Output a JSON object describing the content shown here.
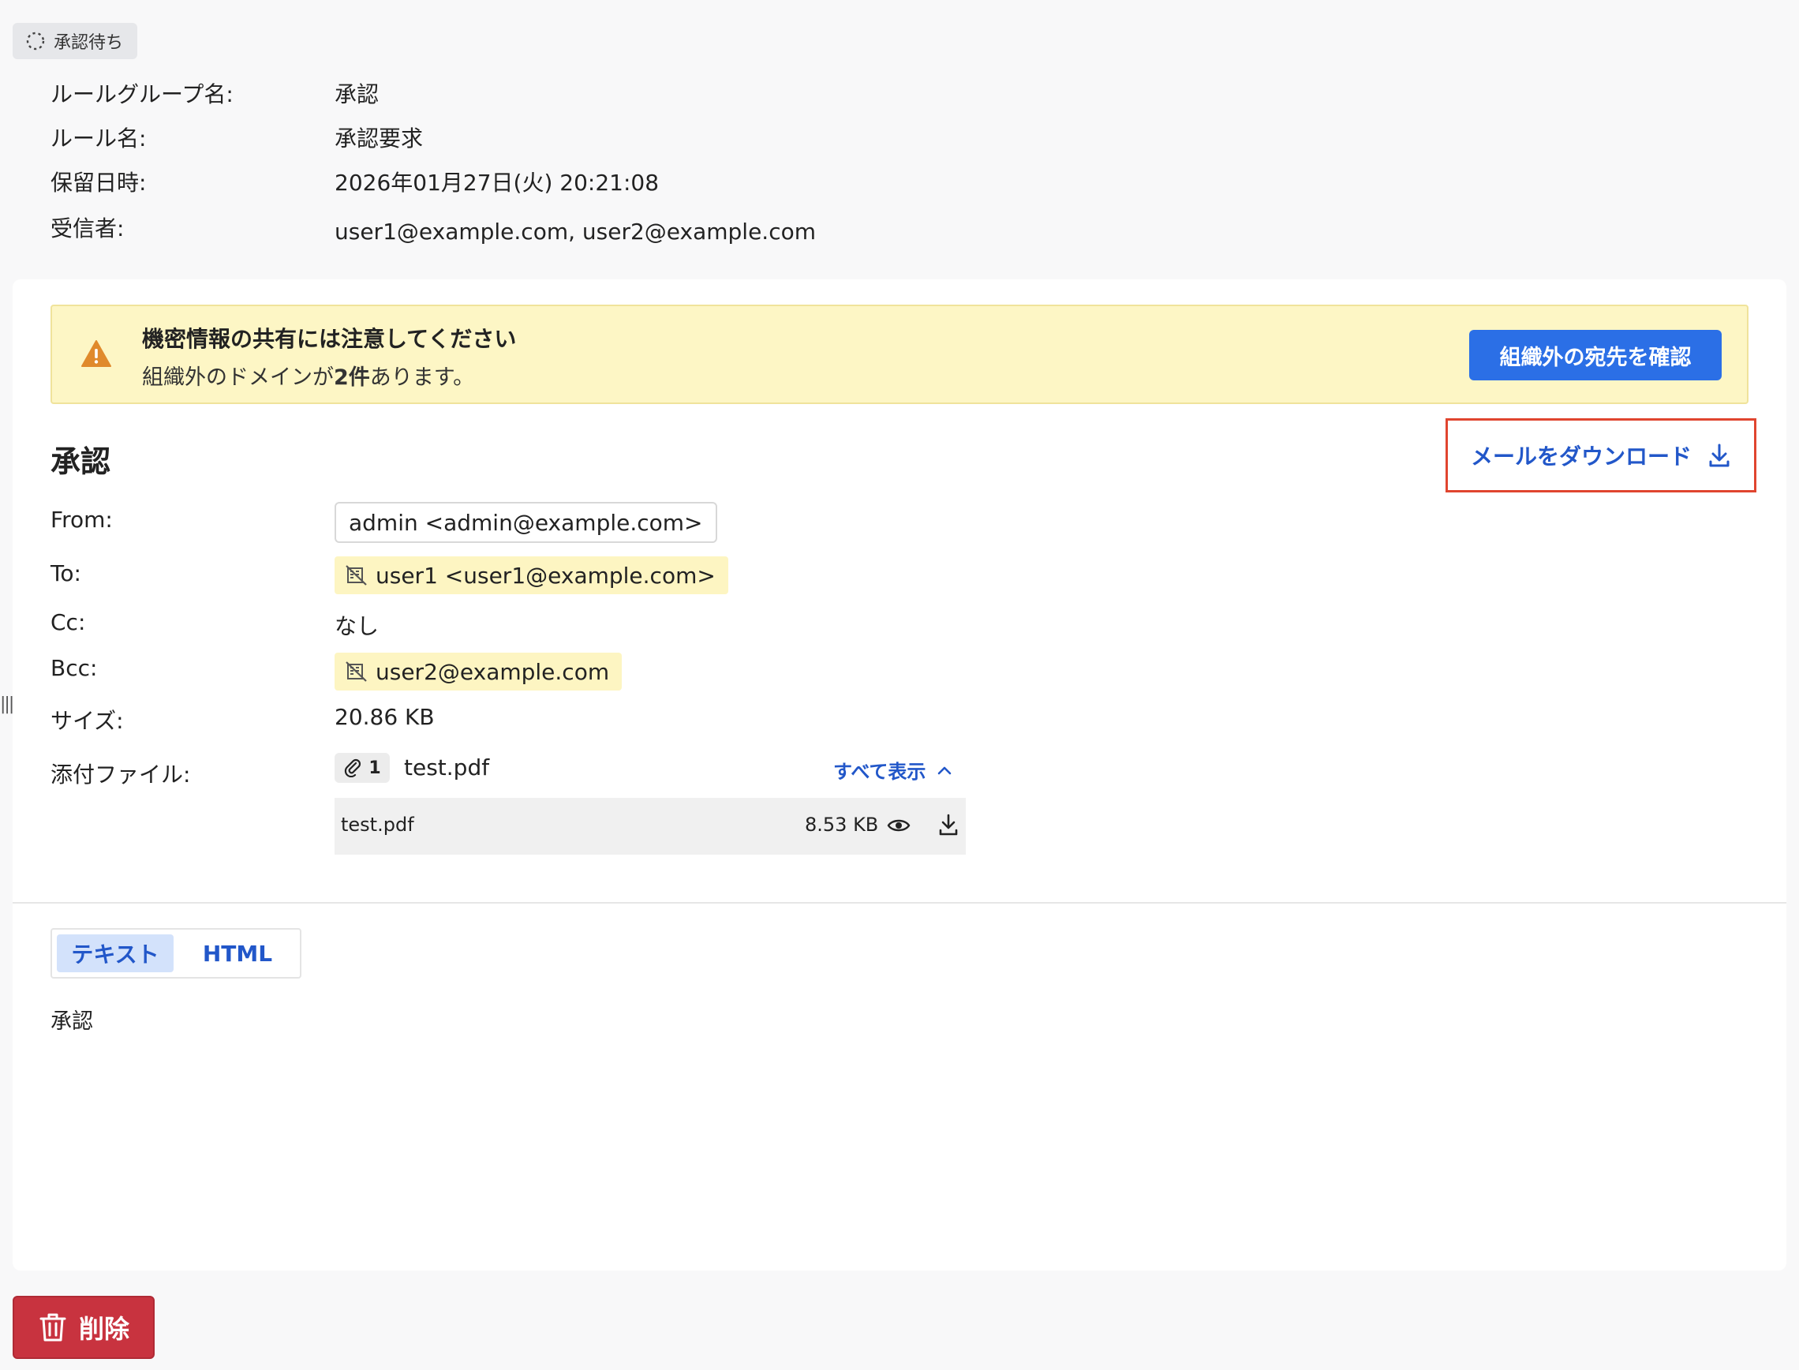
{
  "status": {
    "label": "承認待ち"
  },
  "meta": {
    "rule_group_label": "ルールグループ名:",
    "rule_group_value": "承認",
    "rule_label": "ルール名:",
    "rule_value": "承認要求",
    "held_label": "保留日時:",
    "held_value": "2026年01月27日(火) 20:21:08",
    "recipients_label": "受信者:",
    "recipients_value": "user1@example.com,  user2@example.com"
  },
  "alert": {
    "title": "機密情報の共有には注意してください",
    "desc_prefix": "組織外のドメインが",
    "desc_count": "2件",
    "desc_suffix": "あります。",
    "button_label": "組織外の宛先を確認"
  },
  "mail": {
    "title": "承認",
    "download_label": "メールをダウンロード",
    "from_label": "From:",
    "from_value": "admin <admin@example.com>",
    "to_label": "To:",
    "to_value": "user1 <user1@example.com>",
    "cc_label": "Cc:",
    "cc_value": "なし",
    "bcc_label": "Bcc:",
    "bcc_value": "user2@example.com",
    "size_label": "サイズ:",
    "size_value": "20.86 KB",
    "attach_label": "添付ファイル:",
    "attach_count": "1",
    "attach_first_name": "test.pdf",
    "show_all_label": "すべて表示",
    "attachments": [
      {
        "name": "test.pdf",
        "size": "8.53 KB"
      }
    ]
  },
  "tabs": {
    "text_label": "テキスト",
    "html_label": "HTML"
  },
  "body": {
    "text": "承認"
  },
  "actions": {
    "delete_label": "削除"
  },
  "colors": {
    "accent": "#2b6fe6",
    "link": "#2257c9",
    "alert_bg": "#fdf6c5",
    "warn": "#e08a2c",
    "danger": "#c8333f",
    "highlight_border": "#e0452f"
  }
}
